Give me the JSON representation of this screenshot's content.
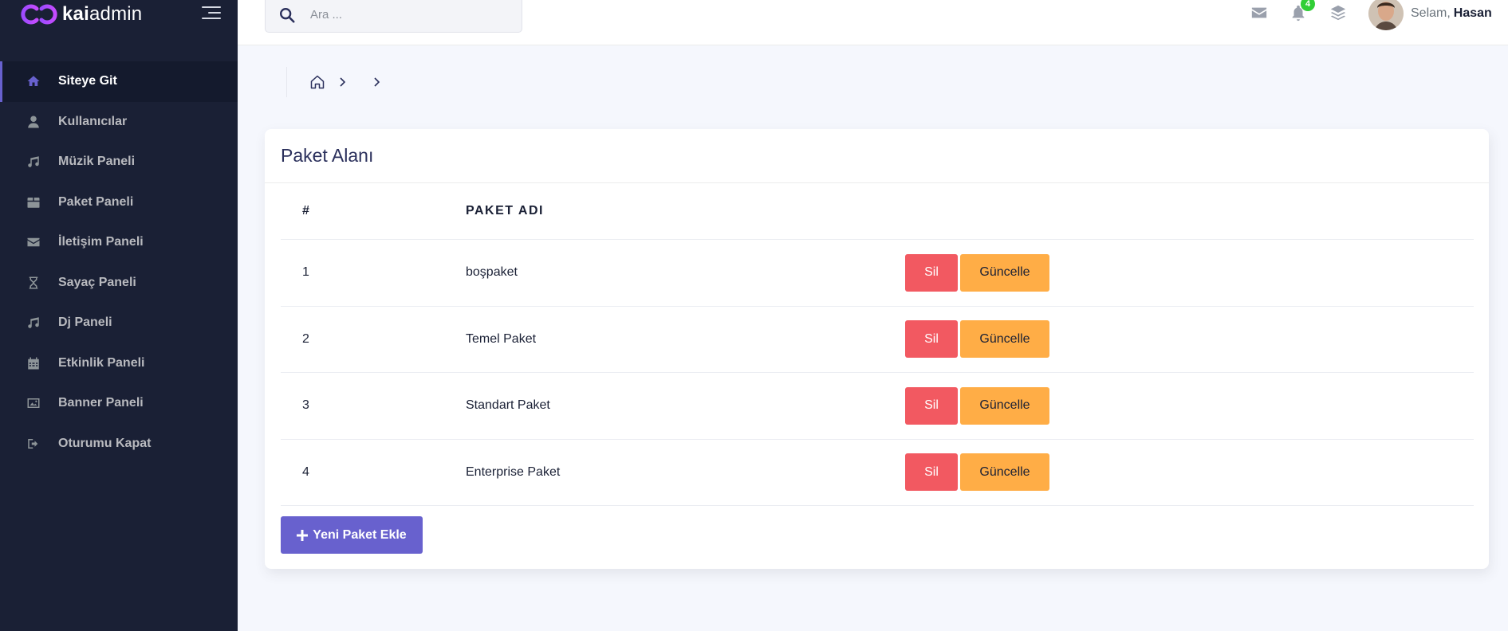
{
  "brand": {
    "name_bold": "kai",
    "name_rest": "admin"
  },
  "sidebar": {
    "items": [
      {
        "label": "Siteye Git",
        "icon": "home-icon",
        "active": true
      },
      {
        "label": "Kullanıcılar",
        "icon": "user-icon"
      },
      {
        "label": "Müzik Paneli",
        "icon": "music-icon"
      },
      {
        "label": "Paket Paneli",
        "icon": "box-icon"
      },
      {
        "label": "İletişim Paneli",
        "icon": "envelope-icon"
      },
      {
        "label": "Sayaç Paneli",
        "icon": "hourglass-icon"
      },
      {
        "label": "Dj Paneli",
        "icon": "music-icon"
      },
      {
        "label": "Etkinlik Paneli",
        "icon": "calendar-icon"
      },
      {
        "label": "Banner Paneli",
        "icon": "image-icon"
      },
      {
        "label": "Oturumu Kapat",
        "icon": "sign-out-icon"
      }
    ]
  },
  "header": {
    "search_placeholder": "Ara ...",
    "notification_count": "4",
    "greeting": "Selam,",
    "user_name": "Hasan"
  },
  "card": {
    "title": "Paket Alanı",
    "columns": [
      "#",
      "PAKET ADI"
    ],
    "rows": [
      {
        "num": "1",
        "name": "boşpaket"
      },
      {
        "num": "2",
        "name": "Temel Paket"
      },
      {
        "num": "3",
        "name": "Standart Paket"
      },
      {
        "num": "4",
        "name": "Enterprise Paket"
      }
    ],
    "delete_label": "Sil",
    "update_label": "Güncelle",
    "add_label": "Yeni Paket Ekle"
  },
  "colors": {
    "sidebar_bg": "#1a2035",
    "accent": "#6861ce",
    "danger": "#f25961",
    "warning": "#ffad46",
    "badge": "#31ce36"
  }
}
